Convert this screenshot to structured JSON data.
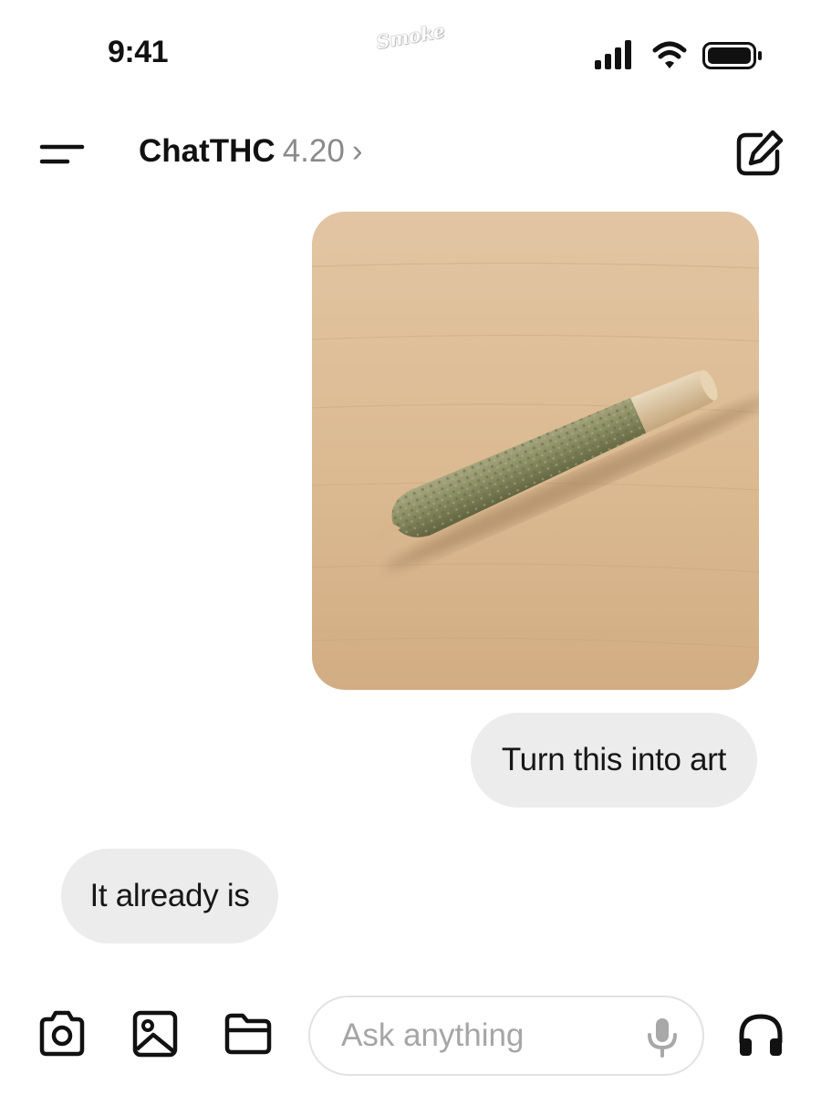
{
  "status_bar": {
    "time": "9:41",
    "watermark": "Smoke",
    "icons": [
      "signal-icon",
      "wifi-icon",
      "battery-icon"
    ]
  },
  "header": {
    "title": "ChatTHC",
    "version": "4.20",
    "chevron": "›",
    "icons": {
      "menu": "menu-icon",
      "new_chat": "compose-icon"
    }
  },
  "messages": [
    {
      "role": "user",
      "type": "image",
      "description_icon": "image-attachment"
    },
    {
      "role": "user",
      "type": "text",
      "text": "Turn this into art"
    },
    {
      "role": "assistant",
      "type": "text",
      "text": "It already is"
    }
  ],
  "composer": {
    "placeholder": "Ask anything",
    "value": "",
    "tools": [
      "camera-icon",
      "photo-icon",
      "folder-icon"
    ],
    "mic_icon": "microphone-icon",
    "voice_icon": "headphones-icon"
  },
  "colors": {
    "bubble": "#ececec",
    "text": "#111111",
    "muted": "#8a8a8a",
    "placeholder": "#a6a6a6",
    "wood": "#dcbb94"
  }
}
